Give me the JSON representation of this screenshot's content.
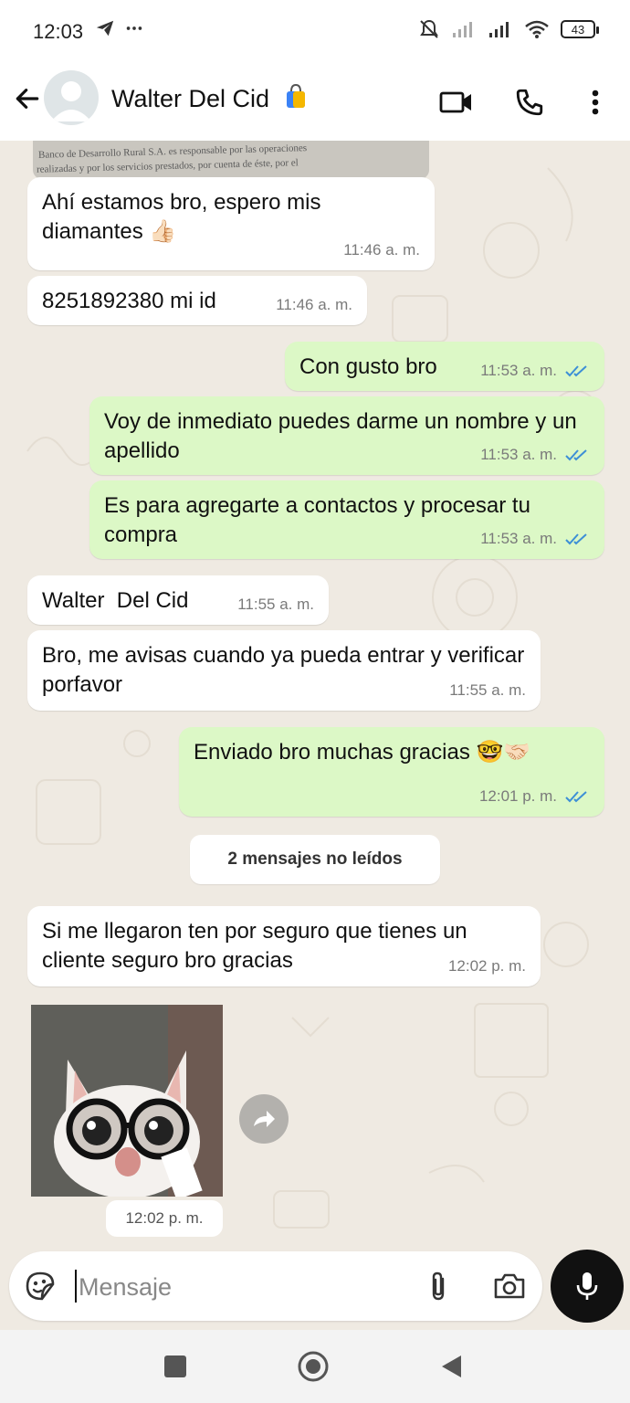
{
  "status_bar": {
    "time": "12:03",
    "battery": "43"
  },
  "header": {
    "contact_name": "Walter Del Cid"
  },
  "doc_preview": {
    "line1": "Banco de Desarrollo Rural S.A. es responsable por las operaciones",
    "line2": "realizadas y por los servicios prestados, por cuenta de éste, por el"
  },
  "messages": [
    {
      "text": "Ahí estamos bro, espero mis diamantes 👍🏻",
      "time": "11:46 a. m."
    },
    {
      "text": "8251892380 mi id",
      "time": "11:46 a. m."
    },
    {
      "text": "Con gusto bro",
      "time": "11:53 a. m."
    },
    {
      "text": "Voy de inmediato puedes darme un nombre y un apellido",
      "time": "11:53 a. m."
    },
    {
      "text": "Es para agregarte a contactos y procesar tu compra",
      "time": "11:53 a. m."
    },
    {
      "text": "Walter  Del Cid",
      "time": "11:55 a. m."
    },
    {
      "text": "Bro, me avisas cuando ya pueda entrar y verificar porfavor",
      "time": "11:55 a. m."
    },
    {
      "text": "Enviado bro muchas gracias 🤓🤝🏻",
      "time": "12:01 p. m."
    },
    {
      "text": "Si me llegaron ten por seguro que tienes un cliente seguro bro gracias",
      "time": "12:02 p. m."
    }
  ],
  "unread_label": "2 mensajes no leídos",
  "sticker": {
    "time": "12:02 p. m."
  },
  "composer": {
    "placeholder": "Mensaje"
  },
  "colors": {
    "outgoing_bubble": "#dcf8c6",
    "incoming_bubble": "#ffffff",
    "read_ticks": "#3d8fd6",
    "chat_bg": "#efeae2"
  }
}
